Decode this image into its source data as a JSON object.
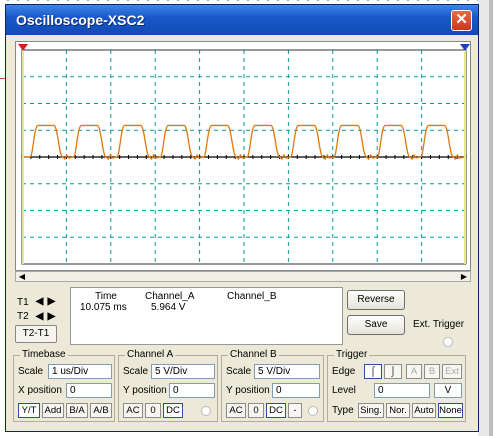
{
  "window": {
    "title": "Oscilloscope-XSC2",
    "close_label": "✕"
  },
  "cursors": {
    "t1_label": "T1",
    "t2_label": "T2",
    "t2t1_label": "T2-T1",
    "left_arrow": "◀",
    "right_arrow": "▶"
  },
  "readout": {
    "time_header": "Time",
    "cha_header": "Channel_A",
    "chb_header": "Channel_B",
    "time_value": "10.075 ms",
    "cha_value": "5.964 V",
    "chb_value": ""
  },
  "actions": {
    "reverse": "Reverse",
    "save": "Save",
    "ext_trigger": "Ext. Trigger"
  },
  "timebase": {
    "title": "Timebase",
    "scale_label": "Scale",
    "scale_value": "1 us/Div",
    "xpos_label": "X position",
    "xpos_value": "0",
    "modes": [
      "Y/T",
      "Add",
      "B/A",
      "A/B"
    ]
  },
  "channel_a": {
    "title": "Channel A",
    "scale_label": "Scale",
    "scale_value": "5  V/Div",
    "ypos_label": "Y position",
    "ypos_value": "0",
    "coupling": [
      "AC",
      "0",
      "DC"
    ]
  },
  "channel_b": {
    "title": "Channel B",
    "scale_label": "Scale",
    "scale_value": "5  V/Div",
    "ypos_label": "Y position",
    "ypos_value": "0",
    "coupling": [
      "AC",
      "0",
      "DC",
      "-"
    ]
  },
  "trigger": {
    "title": "Trigger",
    "edge_label": "Edge",
    "edge_rise": "⌠",
    "edge_fall": "⌡",
    "src_a": "A",
    "src_b": "B",
    "src_ext": "Ext",
    "level_label": "Level",
    "level_value": "0",
    "level_unit": "V",
    "type_label": "Type",
    "types": [
      "Sing.",
      "Nor.",
      "Auto",
      "None"
    ]
  },
  "colors": {
    "trace": "#e07a10",
    "grid": "#00a0a0",
    "cursor1": "#d02020",
    "cursor2": "#2040c0",
    "cursor_line": "#e8e88a"
  },
  "chart_data": {
    "type": "line",
    "series": [
      {
        "values": [
          0,
          0,
          0,
          5.9,
          5.9,
          5.9,
          0,
          0,
          5.9,
          5.9,
          5.9,
          0,
          0,
          5.9,
          5.9,
          5.9,
          0,
          0,
          5.9,
          5.9,
          5.9,
          0,
          0,
          5.9,
          5.9,
          5.9,
          0,
          0,
          5.9,
          5.9,
          5.9,
          0,
          0,
          5.9,
          5.9,
          5.9,
          0,
          0,
          5.9,
          5.9,
          5.9,
          0,
          0,
          5.9,
          5.9,
          5.9,
          0,
          0,
          5.9,
          5.9,
          5.9,
          0,
          0,
          0
        ]
      }
    ],
    "pulses": 10,
    "high_level_v": 5.9,
    "low_level_v": 0,
    "ylim": [
      -20,
      20
    ],
    "grid": true
  }
}
